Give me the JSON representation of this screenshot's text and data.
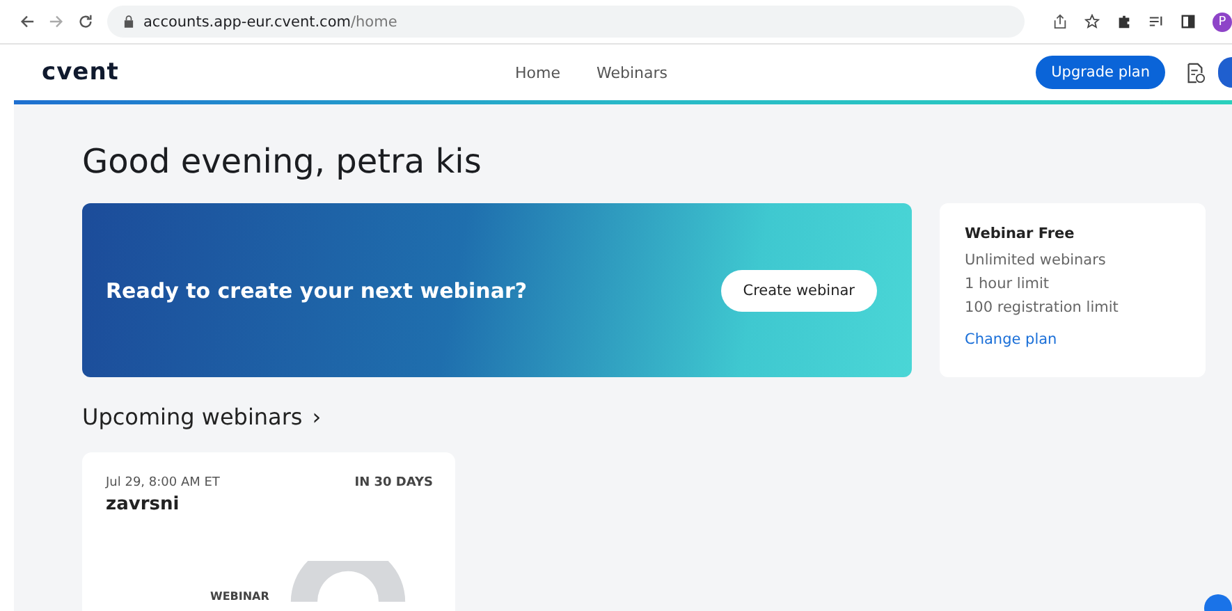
{
  "browser": {
    "url_host": "accounts.app-eur.cvent.com",
    "url_path": "/home",
    "profile_initial": "P"
  },
  "header": {
    "logo": "cvent",
    "nav": [
      {
        "label": "Home",
        "selected": false
      },
      {
        "label": "Webinars",
        "selected": false
      }
    ],
    "upgrade_button": "Upgrade plan"
  },
  "greeting": "Good evening, petra kis",
  "banner": {
    "text": "Ready to create your next webinar?",
    "button": "Create webinar"
  },
  "plan": {
    "title": "Webinar Free",
    "features": [
      "Unlimited webinars",
      "1 hour limit",
      "100 registration limit"
    ],
    "link": "Change plan"
  },
  "upcoming": {
    "title": "Upcoming webinars",
    "chevron": "›",
    "cards": [
      {
        "date": "Jul 29, 8:00 AM ET",
        "countdown": "IN 30 DAYS",
        "name": "zavrsni",
        "label": "WEBINAR"
      }
    ]
  }
}
